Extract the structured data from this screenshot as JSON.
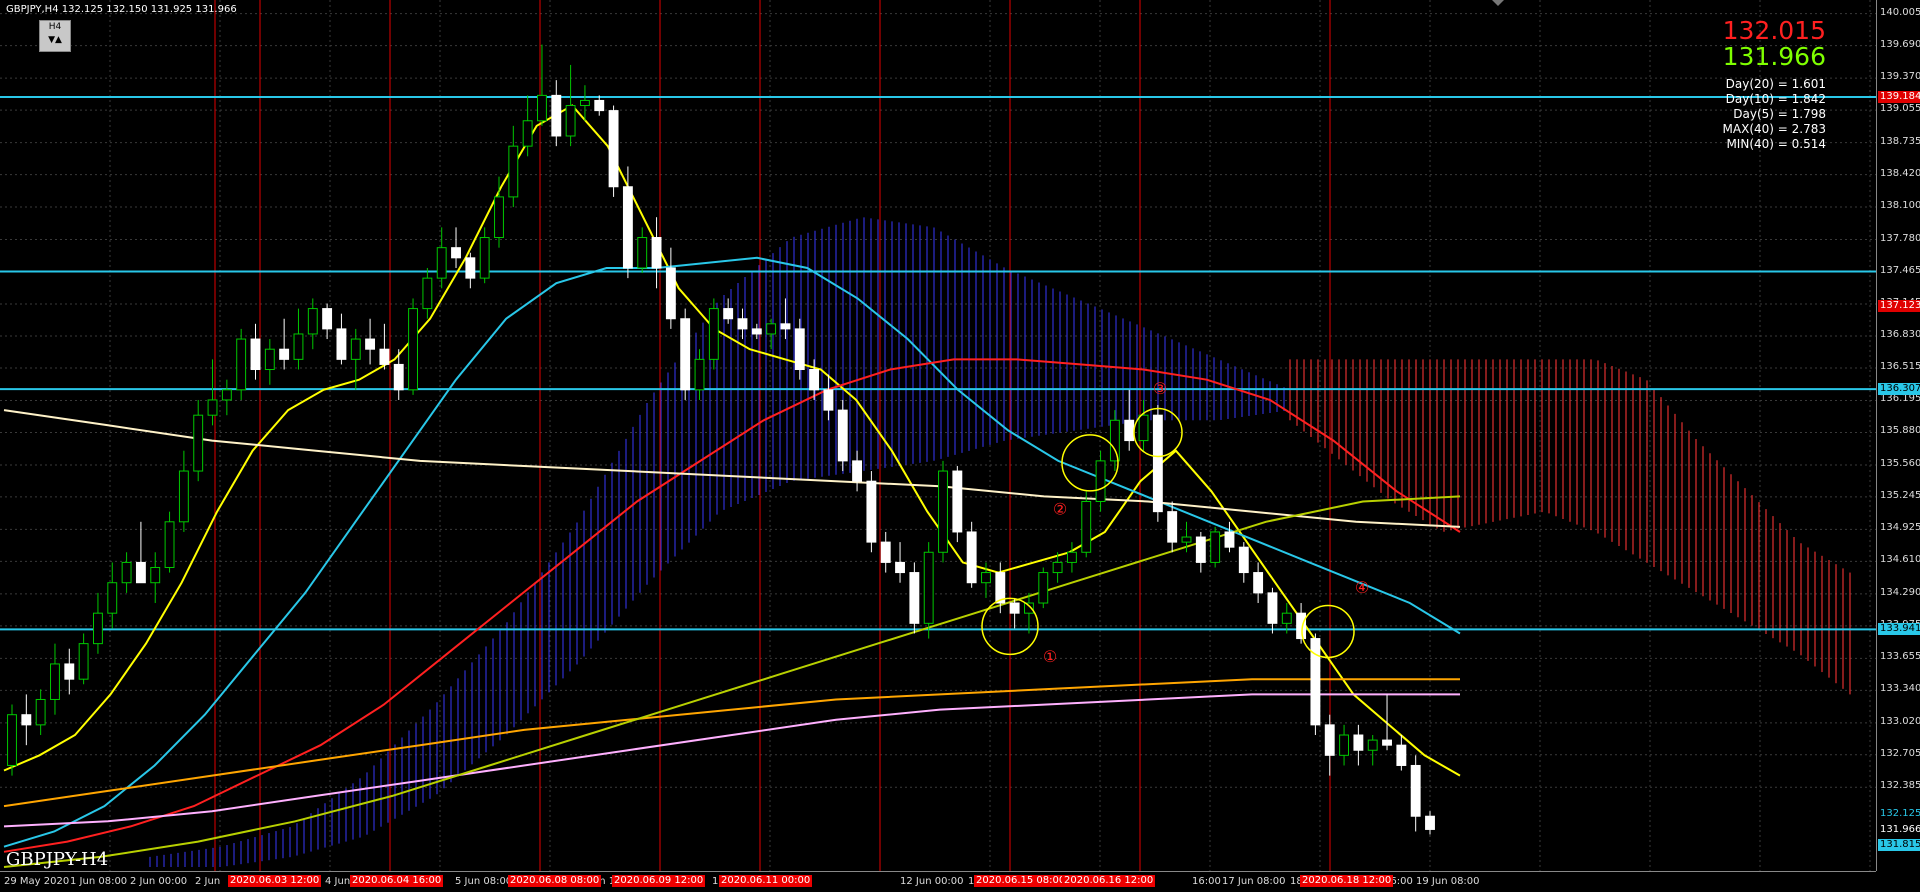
{
  "symbol_header": "GBPJPY,H4  132.125 132.150 131.925 131.966",
  "timeframe_box": {
    "label": "H4",
    "arrows": "▼▲"
  },
  "prices": {
    "bid": "132.015",
    "ask": "131.966"
  },
  "stats": [
    "Day(20) = 1.601",
    "Day(10) = 1.842",
    "Day(5) = 1.798",
    "MAX(40) = 2.783",
    "MIN(40) = 0.514"
  ],
  "watermark": "GBPJPY-H4",
  "price_axis": {
    "labels": [
      "140.005",
      "139.690",
      "139.370",
      "139.055",
      "138.735",
      "138.420",
      "138.100",
      "137.780",
      "137.465",
      "137.145",
      "136.830",
      "136.515",
      "136.195",
      "135.880",
      "135.560",
      "135.245",
      "134.925",
      "134.610",
      "134.290",
      "133.975",
      "133.655",
      "133.340",
      "133.020",
      "132.705",
      "132.385"
    ],
    "tags": [
      {
        "text": "139.184",
        "value": 139.184,
        "bg": "#e00000",
        "fg": "#ffffff"
      },
      {
        "text": "137.123",
        "value": 137.123,
        "bg": "#e00000",
        "fg": "#ffffff"
      },
      {
        "text": "136.307",
        "value": 136.307,
        "bg": "#29c7e8",
        "fg": "#000000"
      },
      {
        "text": "133.941",
        "value": 133.941,
        "bg": "#29c7e8",
        "fg": "#000000"
      },
      {
        "text": "132.125",
        "value": 132.125,
        "bg": "#000000",
        "fg": "#29c7e8"
      },
      {
        "text": "131.966",
        "value": 131.966,
        "bg": "#000000",
        "fg": "#ffffff"
      },
      {
        "text": "131.815",
        "value": 131.815,
        "bg": "#29c7e8",
        "fg": "#000000"
      }
    ]
  },
  "time_axis": {
    "labels": [
      "29 May 2020",
      "1 Jun 08:00",
      "2 Jun 00:00",
      "2 Jun",
      "4 Jun",
      "5 Jun 08:00",
      "Jun 16:00",
      "10",
      "12 Jun 00:00",
      "12",
      "16:00",
      "17 Jun 08:00",
      "18",
      "16:00",
      "19 Jun 08:00"
    ],
    "tags": [
      "2020.06.03 12:00",
      "2020.06.04 16:00",
      "2020.06.08 08:00",
      "2020.06.09 12:00",
      "2020.06.11 00:00",
      "2020.06.15 08:00",
      "2020.06.16 12:00",
      "2020.06.18 12:00"
    ]
  },
  "markers": [
    "①",
    "②",
    "③",
    "④"
  ],
  "colors": {
    "bull": "#00c800",
    "bear": "#ffffff",
    "hline": "#29c7e8",
    "vline": "#e00000",
    "ma_yellow": "#ffff00",
    "ma_cyan": "#29c7e8",
    "ma_red": "#ff2020",
    "ma_cream": "#fff2c8",
    "ma_orange": "#ffa500",
    "ma_pink": "#ffb0ff",
    "ma_olive": "#b8d000",
    "kumo_blue": "#3030d0",
    "kumo_red": "#e03030"
  },
  "chart_data": {
    "type": "candlestick",
    "symbol": "GBPJPY",
    "timeframe": "H4",
    "ylim": [
      131.6,
      140.1
    ],
    "horizontal_levels": [
      139.184,
      137.465,
      136.307,
      133.941
    ],
    "candles": [
      [
        132.6,
        133.2,
        132.5,
        133.1
      ],
      [
        133.1,
        133.3,
        132.8,
        133.0
      ],
      [
        133.0,
        133.35,
        132.9,
        133.25
      ],
      [
        133.25,
        133.8,
        133.1,
        133.6
      ],
      [
        133.6,
        133.75,
        133.3,
        133.45
      ],
      [
        133.45,
        133.9,
        133.4,
        133.8
      ],
      [
        133.8,
        134.3,
        133.7,
        134.1
      ],
      [
        134.1,
        134.6,
        133.95,
        134.4
      ],
      [
        134.4,
        134.7,
        134.3,
        134.6
      ],
      [
        134.6,
        135.0,
        134.5,
        134.4
      ],
      [
        134.4,
        134.7,
        134.2,
        134.55
      ],
      [
        134.55,
        135.1,
        134.5,
        135.0
      ],
      [
        135.0,
        135.7,
        134.9,
        135.5
      ],
      [
        135.5,
        136.2,
        135.4,
        136.05
      ],
      [
        136.05,
        136.6,
        135.95,
        136.2
      ],
      [
        136.2,
        136.4,
        136.05,
        136.3
      ],
      [
        136.3,
        136.9,
        136.2,
        136.8
      ],
      [
        136.8,
        136.95,
        136.4,
        136.5
      ],
      [
        136.5,
        136.8,
        136.35,
        136.7
      ],
      [
        136.7,
        137.0,
        136.5,
        136.6
      ],
      [
        136.6,
        137.1,
        136.5,
        136.85
      ],
      [
        136.85,
        137.2,
        136.7,
        137.1
      ],
      [
        137.1,
        137.15,
        136.8,
        136.9
      ],
      [
        136.9,
        137.05,
        136.55,
        136.6
      ],
      [
        136.6,
        136.9,
        136.3,
        136.8
      ],
      [
        136.8,
        137.0,
        136.55,
        136.7
      ],
      [
        136.7,
        136.95,
        136.5,
        136.55
      ],
      [
        136.55,
        136.7,
        136.2,
        136.3
      ],
      [
        136.3,
        137.2,
        136.25,
        137.1
      ],
      [
        137.1,
        137.5,
        137.0,
        137.4
      ],
      [
        137.4,
        137.9,
        137.3,
        137.7
      ],
      [
        137.7,
        137.9,
        137.5,
        137.6
      ],
      [
        137.6,
        137.65,
        137.3,
        137.4
      ],
      [
        137.4,
        137.9,
        137.35,
        137.8
      ],
      [
        137.8,
        138.4,
        137.7,
        138.2
      ],
      [
        138.2,
        138.9,
        138.1,
        138.7
      ],
      [
        138.7,
        139.2,
        138.6,
        138.95
      ],
      [
        138.95,
        139.7,
        138.9,
        139.2
      ],
      [
        139.2,
        139.35,
        138.7,
        138.8
      ],
      [
        138.8,
        139.5,
        138.7,
        139.1
      ],
      [
        139.1,
        139.3,
        138.95,
        139.15
      ],
      [
        139.15,
        139.2,
        139.0,
        139.05
      ],
      [
        139.05,
        139.1,
        138.2,
        138.3
      ],
      [
        138.3,
        138.5,
        137.4,
        137.5
      ],
      [
        137.5,
        137.9,
        137.45,
        137.8
      ],
      [
        137.8,
        138.0,
        137.3,
        137.5
      ],
      [
        137.5,
        137.7,
        136.9,
        137.0
      ],
      [
        137.0,
        137.1,
        136.2,
        136.3
      ],
      [
        136.3,
        136.7,
        136.2,
        136.6
      ],
      [
        136.6,
        137.2,
        136.5,
        137.1
      ],
      [
        137.1,
        137.2,
        136.95,
        137.0
      ],
      [
        137.0,
        137.1,
        136.8,
        136.9
      ],
      [
        136.9,
        136.95,
        136.8,
        136.85
      ],
      [
        136.85,
        137.0,
        136.7,
        136.95
      ],
      [
        136.95,
        137.2,
        136.8,
        136.9
      ],
      [
        136.9,
        137.0,
        136.4,
        136.5
      ],
      [
        136.5,
        136.6,
        136.2,
        136.3
      ],
      [
        136.3,
        136.45,
        136.0,
        136.1
      ],
      [
        136.1,
        136.2,
        135.5,
        135.6
      ],
      [
        135.6,
        135.7,
        135.3,
        135.4
      ],
      [
        135.4,
        135.5,
        134.7,
        134.8
      ],
      [
        134.8,
        134.9,
        134.5,
        134.6
      ],
      [
        134.6,
        134.8,
        134.4,
        134.5
      ],
      [
        134.5,
        134.6,
        133.9,
        134.0
      ],
      [
        134.0,
        134.8,
        133.85,
        134.7
      ],
      [
        134.7,
        135.6,
        134.6,
        135.5
      ],
      [
        135.5,
        135.55,
        134.8,
        134.9
      ],
      [
        134.9,
        135.0,
        134.35,
        134.4
      ],
      [
        134.4,
        134.6,
        134.25,
        134.5
      ],
      [
        134.5,
        134.6,
        134.1,
        134.2
      ],
      [
        134.2,
        134.25,
        133.95,
        134.1
      ],
      [
        134.1,
        134.3,
        133.9,
        134.2
      ],
      [
        134.2,
        134.55,
        134.15,
        134.5
      ],
      [
        134.5,
        134.7,
        134.4,
        134.6
      ],
      [
        134.6,
        134.8,
        134.5,
        134.7
      ],
      [
        134.7,
        135.3,
        134.65,
        135.2
      ],
      [
        135.2,
        135.7,
        135.1,
        135.6
      ],
      [
        135.6,
        136.1,
        135.5,
        136.0
      ],
      [
        136.0,
        136.3,
        135.7,
        135.8
      ],
      [
        135.8,
        136.2,
        135.7,
        136.05
      ],
      [
        136.05,
        136.15,
        135.0,
        135.1
      ],
      [
        135.1,
        135.2,
        134.7,
        134.8
      ],
      [
        134.8,
        135.0,
        134.7,
        134.85
      ],
      [
        134.85,
        134.9,
        134.5,
        134.6
      ],
      [
        134.6,
        134.95,
        134.55,
        134.9
      ],
      [
        134.9,
        135.0,
        134.7,
        134.75
      ],
      [
        134.75,
        134.8,
        134.4,
        134.5
      ],
      [
        134.5,
        134.6,
        134.2,
        134.3
      ],
      [
        134.3,
        134.35,
        133.9,
        134.0
      ],
      [
        134.0,
        134.2,
        133.9,
        134.1
      ],
      [
        134.1,
        134.2,
        133.8,
        133.85
      ],
      [
        133.85,
        133.9,
        132.9,
        133.0
      ],
      [
        133.0,
        133.1,
        132.5,
        132.7
      ],
      [
        132.7,
        133.0,
        132.6,
        132.9
      ],
      [
        132.9,
        133.0,
        132.6,
        132.75
      ],
      [
        132.75,
        132.9,
        132.6,
        132.85
      ],
      [
        132.85,
        133.3,
        132.75,
        132.8
      ],
      [
        132.8,
        132.9,
        132.55,
        132.6
      ],
      [
        132.6,
        132.7,
        131.95,
        132.1
      ],
      [
        132.1,
        132.15,
        131.92,
        131.97
      ]
    ],
    "moving_averages": [
      {
        "color": "ma_yellow",
        "values": [
          132.55,
          132.7,
          132.9,
          133.3,
          133.8,
          134.4,
          135.1,
          135.7,
          136.1,
          136.3,
          136.4,
          136.6,
          137.0,
          137.6,
          138.3,
          138.9,
          139.1,
          138.7,
          138.0,
          137.3,
          136.9,
          136.7,
          136.6,
          136.5,
          136.2,
          135.7,
          135.1,
          134.6,
          134.5,
          134.6,
          134.7,
          134.9,
          135.4,
          135.7,
          135.3,
          134.8,
          134.3,
          133.8,
          133.3,
          133.0,
          132.7,
          132.5
        ]
      },
      {
        "color": "ma_cyan",
        "values": [
          131.8,
          131.95,
          132.2,
          132.6,
          133.1,
          133.7,
          134.3,
          135.0,
          135.7,
          136.4,
          137.0,
          137.35,
          137.5,
          137.5,
          137.55,
          137.6,
          137.5,
          137.2,
          136.8,
          136.3,
          135.9,
          135.6,
          135.4,
          135.2,
          135.0,
          134.8,
          134.6,
          134.4,
          134.2,
          133.9
        ]
      },
      {
        "color": "ma_red",
        "values": [
          131.75,
          131.85,
          132.0,
          132.2,
          132.5,
          132.8,
          133.2,
          133.7,
          134.2,
          134.7,
          135.2,
          135.6,
          136.0,
          136.3,
          136.5,
          136.6,
          136.6,
          136.55,
          136.5,
          136.4,
          136.2,
          135.8,
          135.3,
          134.9
        ]
      },
      {
        "color": "ma_cream",
        "values": [
          136.1,
          135.95,
          135.8,
          135.7,
          135.6,
          135.55,
          135.5,
          135.45,
          135.4,
          135.35,
          135.25,
          135.2,
          135.1,
          135.0,
          134.95
        ]
      },
      {
        "color": "ma_orange",
        "values": [
          132.2,
          132.35,
          132.5,
          132.65,
          132.8,
          132.95,
          133.05,
          133.15,
          133.25,
          133.3,
          133.35,
          133.4,
          133.45,
          133.45,
          133.45
        ]
      },
      {
        "color": "ma_pink",
        "values": [
          132.0,
          132.05,
          132.15,
          132.3,
          132.45,
          132.6,
          132.75,
          132.9,
          133.05,
          133.15,
          133.2,
          133.25,
          133.3,
          133.3,
          133.3
        ]
      },
      {
        "color": "ma_olive",
        "values": [
          131.6,
          131.7,
          131.85,
          132.05,
          132.3,
          132.6,
          132.9,
          133.2,
          133.5,
          133.8,
          134.1,
          134.4,
          134.7,
          135.0,
          135.2,
          135.25
        ]
      }
    ],
    "kumo_blue": {
      "top": [
        131.7,
        131.8,
        132.0,
        132.5,
        133.2,
        134.0,
        135.0,
        136.2,
        137.2,
        137.8,
        138.0,
        137.9,
        137.5,
        137.2,
        136.9,
        136.6,
        136.3
      ],
      "bottom": [
        131.6,
        131.6,
        131.7,
        131.9,
        132.3,
        132.9,
        133.6,
        134.4,
        135.1,
        135.4,
        135.5,
        135.6,
        135.8,
        135.9,
        136.0,
        136.0,
        136.1
      ]
    },
    "kumo_red": {
      "top": [
        136.6,
        136.6,
        136.6,
        136.6,
        136.6,
        136.6,
        136.6,
        136.4,
        135.8,
        135.3,
        134.8,
        134.5
      ],
      "bottom": [
        136.0,
        135.6,
        135.2,
        134.9,
        135.0,
        135.1,
        134.9,
        134.6,
        134.3,
        134.0,
        133.7,
        133.3
      ]
    }
  }
}
